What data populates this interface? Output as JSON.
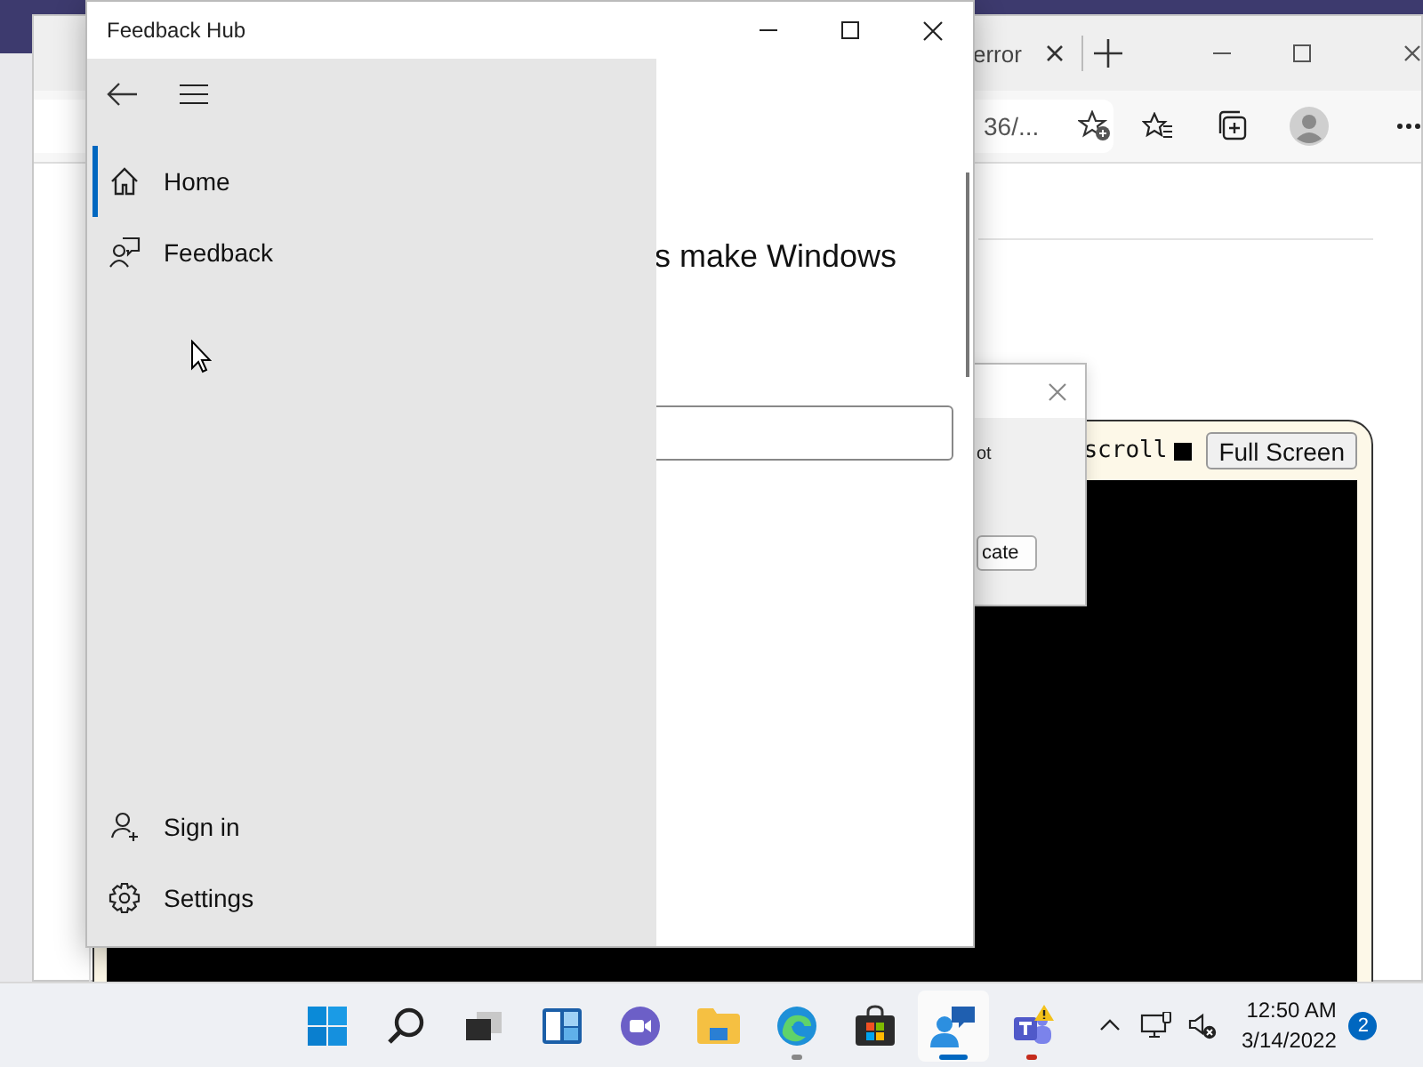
{
  "browser": {
    "tab_title": "error",
    "address": "36/..."
  },
  "terminal": {
    "label": "scroll",
    "checked": true,
    "button": "Full Screen"
  },
  "dialog": {
    "text": "ot",
    "button": "cate"
  },
  "feedback_hub": {
    "title": "Feedback Hub",
    "heading": "s make Windows",
    "nav_items": [
      {
        "label": "Home",
        "selected": true
      },
      {
        "label": "Feedback",
        "selected": false
      }
    ],
    "footer_items": [
      {
        "label": "Sign in"
      },
      {
        "label": "Settings"
      }
    ]
  },
  "taskbar": {
    "apps": [
      {
        "kind": "start",
        "running": false,
        "active": false,
        "alert": false
      },
      {
        "kind": "search",
        "running": false,
        "active": false,
        "alert": false
      },
      {
        "kind": "task-view",
        "running": false,
        "active": false,
        "alert": false
      },
      {
        "kind": "widgets",
        "running": false,
        "active": false,
        "alert": false
      },
      {
        "kind": "meet",
        "running": false,
        "active": false,
        "alert": false
      },
      {
        "kind": "explorer",
        "running": false,
        "active": false,
        "alert": false
      },
      {
        "kind": "edge",
        "running": true,
        "active": false,
        "alert": false
      },
      {
        "kind": "store",
        "running": false,
        "active": false,
        "alert": false
      },
      {
        "kind": "feedback",
        "running": true,
        "active": true,
        "alert": false
      },
      {
        "kind": "teams",
        "running": true,
        "active": false,
        "alert": true
      }
    ],
    "time": "12:50 AM",
    "date": "3/14/2022",
    "notification_count": "2"
  }
}
